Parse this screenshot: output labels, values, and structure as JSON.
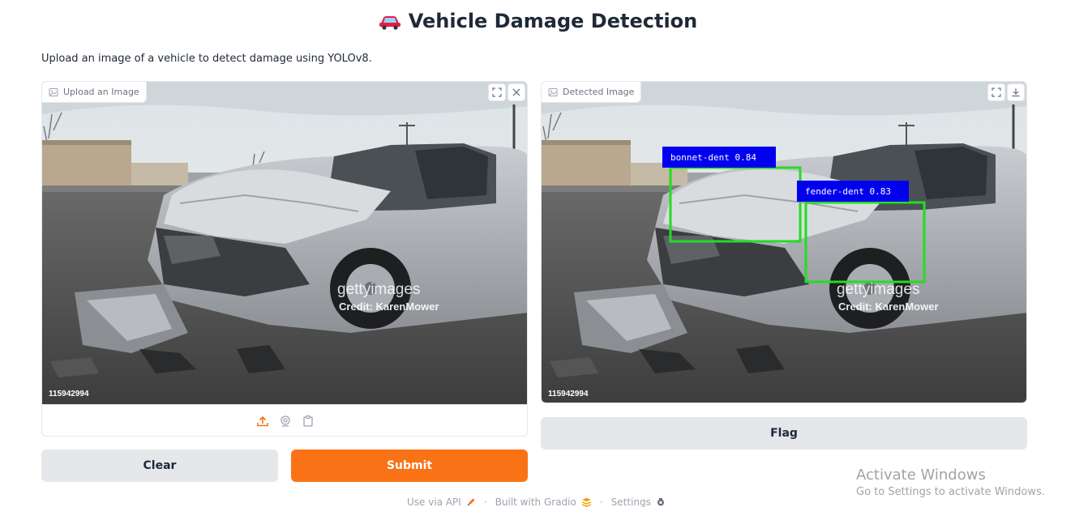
{
  "header": {
    "title": "Vehicle Damage Detection",
    "description": "Upload an image of a vehicle to detect damage using YOLOv8."
  },
  "input_panel": {
    "label": "Upload an Image",
    "image_id": "115942994",
    "watermark_brand": "gettyimages",
    "watermark_credit": "Credit: KarenMower"
  },
  "output_panel": {
    "label": "Detected Image",
    "image_id": "115942994",
    "watermark_brand": "gettyimages",
    "watermark_credit": "Credit: KarenMower",
    "detections": [
      {
        "label": "bonnet-dent 0.84"
      },
      {
        "label": "fender-dent 0.83"
      }
    ]
  },
  "buttons": {
    "clear": "Clear",
    "submit": "Submit",
    "flag": "Flag"
  },
  "footer": {
    "api": "Use via API",
    "built": "Built with Gradio",
    "settings": "Settings"
  },
  "overlay": {
    "activate_title": "Activate Windows",
    "activate_sub": "Go to Settings to activate Windows."
  },
  "colors": {
    "accent": "#f97316",
    "box_green": "#22dd22",
    "label_blue": "#0000ee"
  },
  "icons": [
    "car-icon",
    "image-icon",
    "fullscreen-icon",
    "close-icon",
    "download-icon",
    "upload-icon",
    "webcam-icon",
    "clipboard-icon",
    "rocket-icon",
    "gradio-logo-icon",
    "settings-icon"
  ]
}
